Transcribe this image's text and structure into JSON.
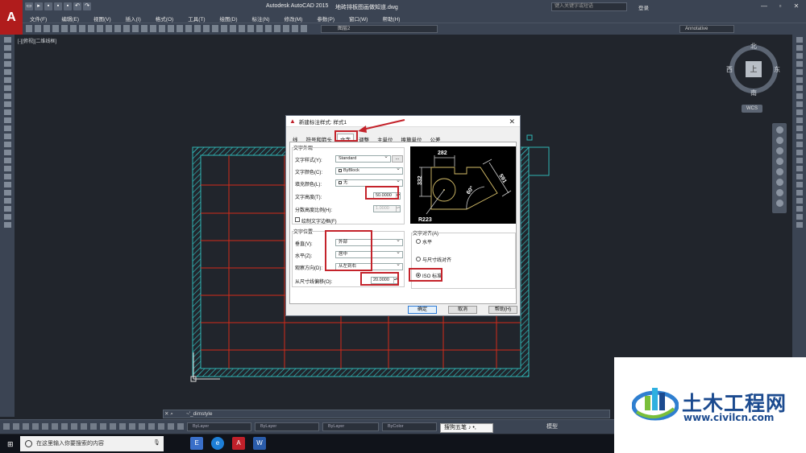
{
  "app": {
    "title": "Autodesk AutoCAD 2015",
    "document": "地砖排板图画做知道.dwg",
    "search_placeholder": "键入关键字或短语",
    "login_label": "登录",
    "logo_letter": "A",
    "win_min": "—",
    "win_restore": "▫",
    "win_close": "✕"
  },
  "menu": [
    "文件(F)",
    "编辑(E)",
    "视图(V)",
    "插入(I)",
    "格式(O)",
    "工具(T)",
    "绘图(D)",
    "标注(N)",
    "修改(M)",
    "参数(P)",
    "窗口(W)",
    "帮助(H)"
  ],
  "toolbar": {
    "layer_value": "图层2",
    "annotation_value": "Annotative"
  },
  "viewport": {
    "label": "[-][俯视][二维线框]"
  },
  "viewcube": {
    "north": "北",
    "south": "南",
    "east": "东",
    "west": "西",
    "top": "上",
    "wcs": "WCS"
  },
  "dialog": {
    "title": "新建标注样式: 样式1",
    "close": "✕",
    "tabs": [
      "线",
      "符号和箭头",
      "文字",
      "调整",
      "主单位",
      "换算单位",
      "公差"
    ],
    "active_tab": "文字",
    "appearance_group": "文字外观",
    "text_style_label": "文字样式(Y):",
    "text_style_value": "Standard",
    "text_style_btn": "...",
    "text_color_label": "文字颜色(C):",
    "text_color_value": "ByBlock",
    "fill_color_label": "填充颜色(L):",
    "fill_color_value": "无",
    "text_height_label": "文字高度(T):",
    "text_height_value": "50.0000",
    "fraction_scale_label": "分数高度比例(H):",
    "fraction_scale_value": "1.0000",
    "draw_frame_label": "绘制文字边框(F)",
    "placement_group": "文字位置",
    "vertical_label": "垂直(V):",
    "vertical_value": "外部",
    "horizontal_label": "水平(Z):",
    "horizontal_value": "居中",
    "view_direction_label": "观察方向(D):",
    "view_direction_value": "从左到右",
    "offset_label": "从尺寸线偏移(O):",
    "offset_value": "20.0000",
    "alignment_group": "文字对齐(A)",
    "align_options": [
      "水平",
      "与尺寸线对齐",
      "ISO 标准"
    ],
    "align_selected": "ISO 标准",
    "preview": {
      "dim_top": "282",
      "dim_left": "332",
      "dim_diag": "591",
      "angle": "60°",
      "radius": "R223"
    },
    "ok": "确定",
    "cancel": "取消",
    "help": "帮助(H)"
  },
  "command": {
    "x_label": "✕ ⌕",
    "text": "~'_dimstyle"
  },
  "status": {
    "prop1": "ByLayer",
    "prop2": "ByLayer",
    "prop3": "ByLayer",
    "prop4": "ByColor",
    "ime": "搜狗五笔 ♪ •,",
    "model": "模型"
  },
  "taskbar": {
    "start": "⊞",
    "search_placeholder": "在这里输入你要搜索的内容",
    "mic": "🎙",
    "apps": [
      "E",
      "e",
      "A",
      "W"
    ]
  },
  "watermark": {
    "cn": "土木工程网",
    "url": "www.civilcn.com"
  },
  "colors": {
    "accent_red": "#c4232b",
    "hatch": "#2fb5b5",
    "grid": "#d22a1a"
  }
}
